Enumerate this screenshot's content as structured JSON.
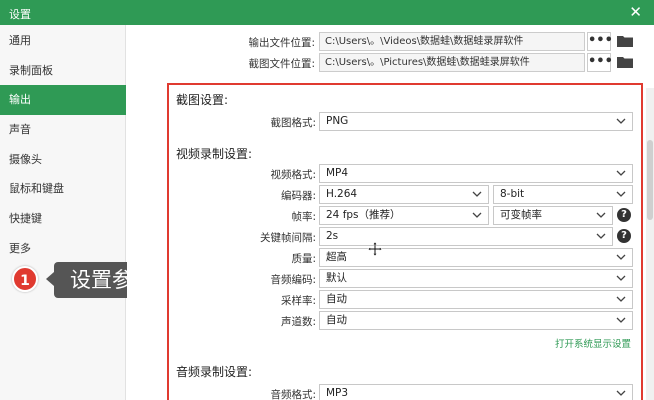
{
  "window": {
    "title": "设置",
    "close_glyph": "✕"
  },
  "sidebar": {
    "items": [
      {
        "label": "通用",
        "active": false
      },
      {
        "label": "录制面板",
        "active": false
      },
      {
        "label": "输出",
        "active": true
      },
      {
        "label": "声音",
        "active": false
      },
      {
        "label": "摄像头",
        "active": false
      },
      {
        "label": "鼠标和键盘",
        "active": false
      },
      {
        "label": "快捷键",
        "active": false
      },
      {
        "label": "更多",
        "active": false
      }
    ]
  },
  "callout": {
    "number": "1",
    "text": "设置参数"
  },
  "output_paths": {
    "video": {
      "label": "输出文件位置:",
      "value": "C:\\Users\\。\\Videos\\数据蛙\\数据蛙录屏软件",
      "browse": "•••"
    },
    "screenshot": {
      "label": "截图文件位置:",
      "value": "C:\\Users\\。\\Pictures\\数据蛙\\数据蛙录屏软件",
      "browse": "•••"
    }
  },
  "screenshot_settings": {
    "heading": "截图设置:",
    "format": {
      "label": "截图格式:",
      "value": "PNG"
    }
  },
  "video_settings": {
    "heading": "视频录制设置:",
    "format": {
      "label": "视频格式:",
      "value": "MP4"
    },
    "encoder": {
      "label": "编码器:",
      "value": "H.264",
      "depth": "8-bit"
    },
    "framerate": {
      "label": "帧率:",
      "value": "24 fps（推荐）",
      "mode": "可变帧率"
    },
    "keyframe": {
      "label": "关键帧间隔:",
      "value": "2s"
    },
    "quality": {
      "label": "质量:",
      "value": "超高"
    },
    "audio_codec": {
      "label": "音频编码:",
      "value": "默认"
    },
    "sample_rate": {
      "label": "采样率:",
      "value": "自动"
    },
    "channels": {
      "label": "声道数:",
      "value": "自动"
    },
    "display_link": "打开系统显示设置"
  },
  "audio_settings": {
    "heading": "音频录制设置:",
    "format": {
      "label": "音频格式:",
      "value": "MP3"
    }
  },
  "help_glyph": "?",
  "colors": {
    "accent": "#2f9a55",
    "highlight_frame": "#e03a30",
    "callout_bg": "#555555",
    "callout_badge": "#e03a30"
  }
}
